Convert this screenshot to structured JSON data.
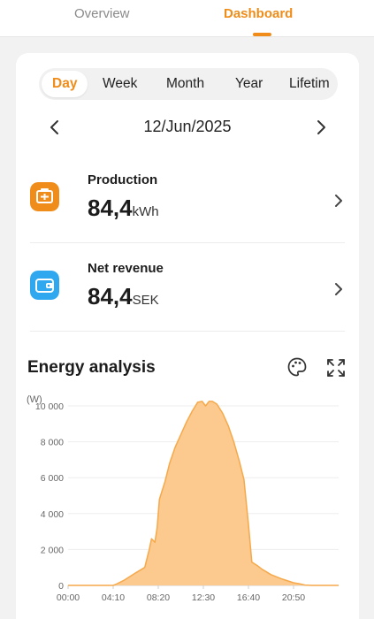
{
  "tabs": {
    "overview": "Overview",
    "dashboard": "Dashboard",
    "active": "Dashboard"
  },
  "periods": [
    "Day",
    "Week",
    "Month",
    "Year",
    "Lifetim"
  ],
  "active_period": "Day",
  "date": "12/Jun/2025",
  "metrics": {
    "production": {
      "title": "Production",
      "value": "84,4",
      "unit": "kWh",
      "icon": "solar-battery-icon",
      "color": "#f08c1a"
    },
    "revenue": {
      "title": "Net revenue",
      "value": "84,4",
      "unit": "SEK",
      "icon": "wallet-icon",
      "color": "#2fa8f0"
    }
  },
  "energy": {
    "title": "Energy analysis",
    "tools": [
      "palette-icon",
      "expand-icon"
    ]
  },
  "chart_data": {
    "type": "area",
    "ylabel": "(W)",
    "yticks": [
      "0",
      "2 000",
      "4 000",
      "6 000",
      "8 000",
      "10 000"
    ],
    "xticks": [
      "00:00",
      "04:10",
      "08:20",
      "12:30",
      "16:40",
      "20:50"
    ],
    "ylim": [
      0,
      10000
    ],
    "grid": true,
    "color": "#f5a94a",
    "fill": "#fcc98f",
    "x_hours": [
      0,
      4.0,
      4.2,
      5.0,
      6.0,
      6.8,
      7.2,
      7.4,
      7.7,
      7.9,
      8.1,
      8.6,
      9.0,
      9.5,
      10.0,
      10.5,
      11.0,
      11.5,
      11.9,
      12.2,
      12.5,
      12.8,
      13.2,
      13.7,
      14.2,
      14.7,
      15.2,
      15.6,
      16.0,
      16.3,
      16.8,
      17.2,
      18.0,
      19.0,
      20.0,
      20.6,
      21.0,
      21.6,
      22.0,
      24.0
    ],
    "values": [
      0,
      0,
      50,
      300,
      700,
      1000,
      2000,
      2600,
      2400,
      3200,
      4800,
      5800,
      6800,
      7700,
      8400,
      9100,
      9700,
      10200,
      10250,
      10000,
      10250,
      10250,
      10100,
      9600,
      8900,
      8000,
      6900,
      5900,
      3400,
      1300,
      1100,
      900,
      600,
      350,
      150,
      80,
      20,
      0,
      0,
      0
    ]
  }
}
